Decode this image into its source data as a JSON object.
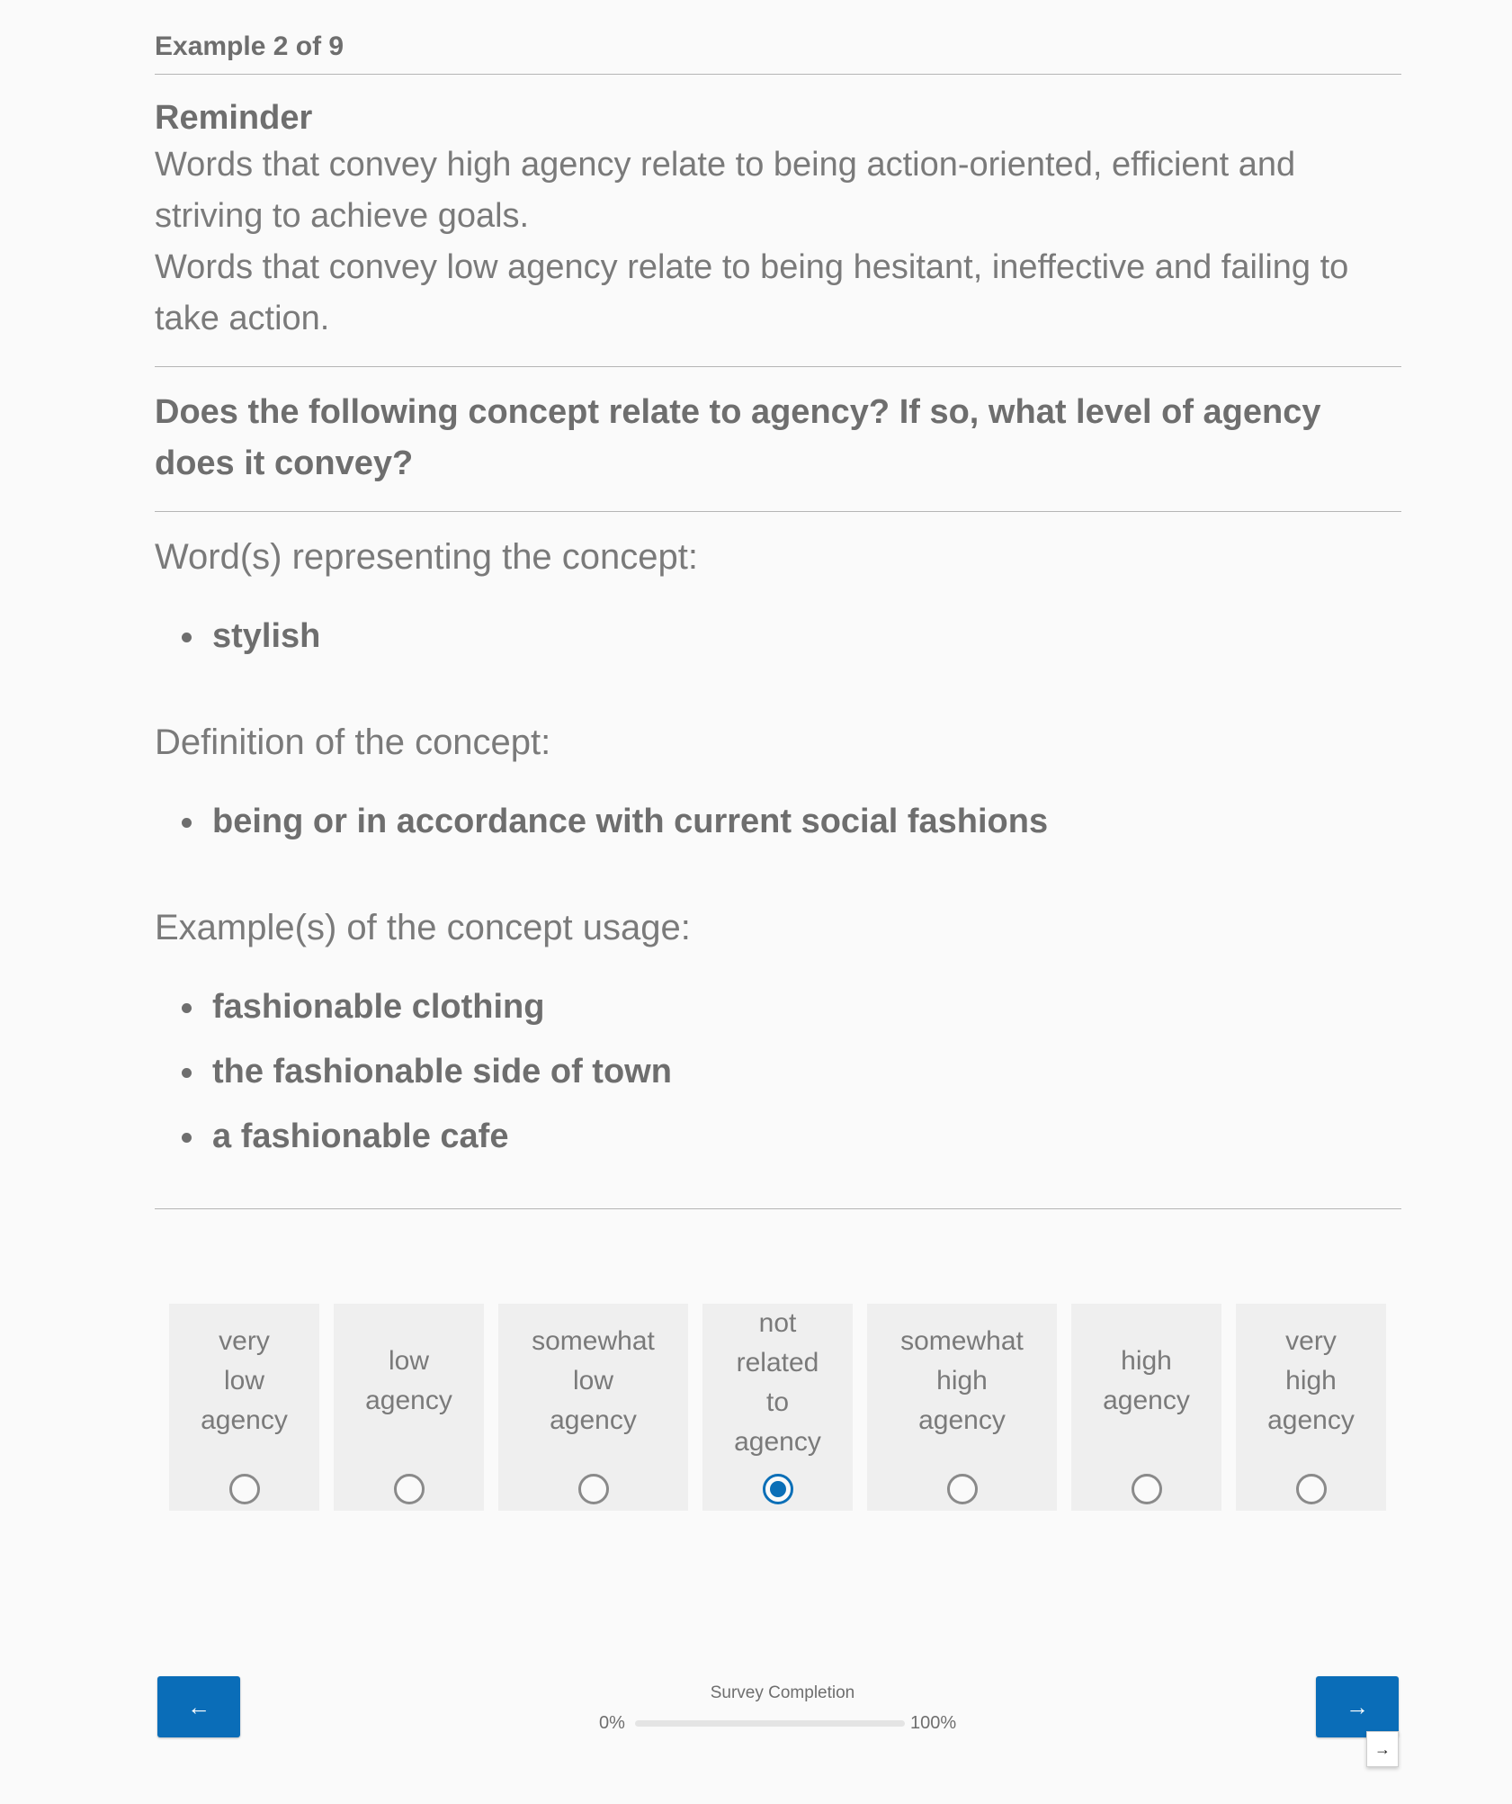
{
  "header": {
    "example_counter": "Example 2 of 9"
  },
  "reminder": {
    "title": "Reminder",
    "high_agency_text": "Words that convey high agency relate to being action-oriented, efficient and striving to achieve goals.",
    "low_agency_text": "Words that convey low agency relate to being hesitant, ineffective and failing to take action."
  },
  "question": {
    "text": "Does the following concept relate to agency? If so, what level of agency does it convey?"
  },
  "concept": {
    "words_label": "Word(s) representing the concept:",
    "words": [
      "stylish"
    ],
    "definition_label": "Definition of the concept:",
    "definitions": [
      "being or in accordance with current social fashions"
    ],
    "examples_label": "Example(s) of the concept usage:",
    "examples": [
      "fashionable clothing",
      "the fashionable side of town",
      "a fashionable cafe"
    ]
  },
  "scale": {
    "options": [
      {
        "lines": [
          "very",
          "low",
          "agency"
        ],
        "selected": false
      },
      {
        "lines": [
          "low",
          "agency"
        ],
        "selected": false
      },
      {
        "lines": [
          "somewhat",
          "low",
          "agency"
        ],
        "selected": false
      },
      {
        "lines": [
          "not",
          "related",
          "to",
          "agency"
        ],
        "selected": true
      },
      {
        "lines": [
          "somewhat",
          "high",
          "agency"
        ],
        "selected": false
      },
      {
        "lines": [
          "high",
          "agency"
        ],
        "selected": false
      },
      {
        "lines": [
          "very",
          "high",
          "agency"
        ],
        "selected": false
      }
    ]
  },
  "navigation": {
    "back_label": "←",
    "next_label": "→",
    "tooltip_label": "→"
  },
  "progress": {
    "caption": "Survey Completion",
    "min_label": "0%",
    "max_label": "100%",
    "value_percent": 0
  },
  "colors": {
    "accent": "#0a6db8",
    "text": "#757575",
    "option_bg": "#efefef"
  }
}
